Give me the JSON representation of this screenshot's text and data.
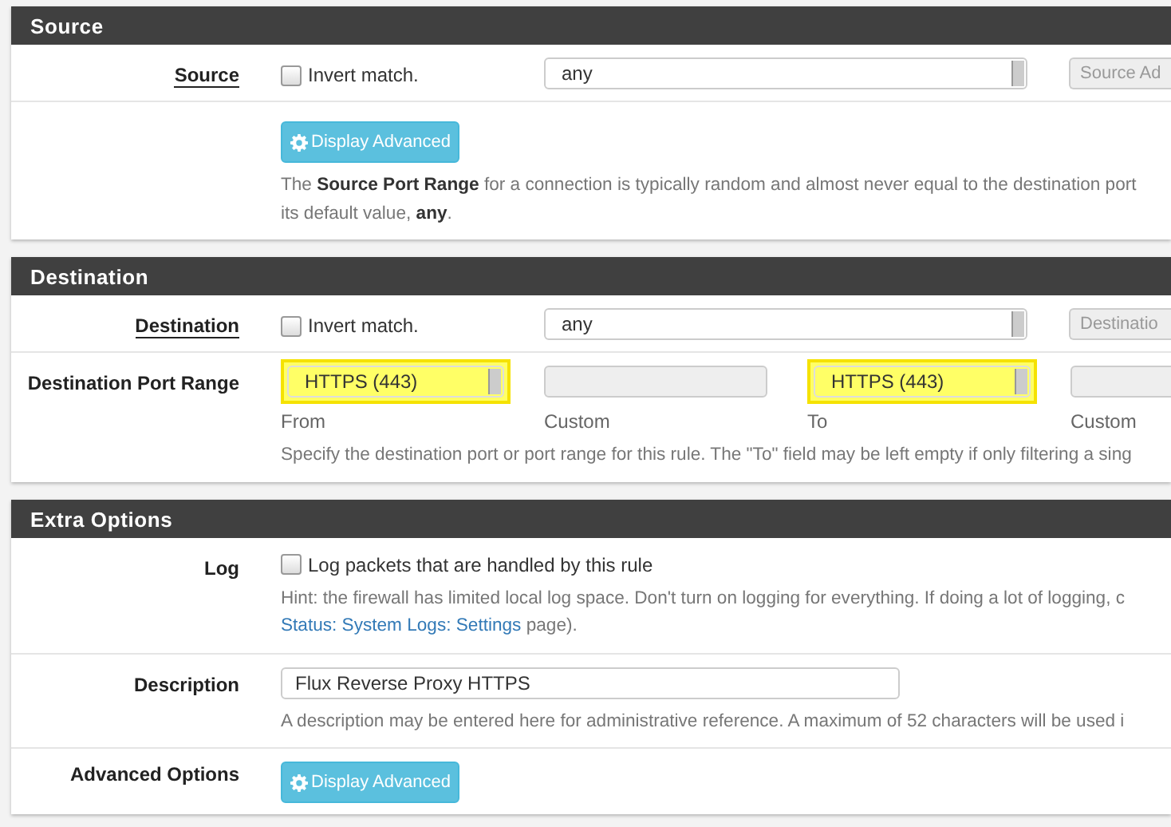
{
  "sections": [
    {
      "title": "Source",
      "rows": [
        {
          "kind": "match",
          "label": "Source",
          "invert": {
            "label": "Invert match.",
            "checked": false
          },
          "select": "any",
          "address_placeholder": "Source Ad"
        },
        {
          "kind": "advanced",
          "button": "Display Advanced",
          "help": "The **Source Port Range** for a connection is typically random and almost never equal to the destination port",
          "help_2": "its default value, **any**."
        }
      ]
    },
    {
      "title": "Destination",
      "rows": [
        {
          "kind": "match",
          "label": "Destination",
          "invert": {
            "label": "Invert match.",
            "checked": false
          },
          "select": "any",
          "address_placeholder": "Destinatio"
        },
        {
          "kind": "port_range",
          "label": "Destination Port Range",
          "ports": [
            {
              "select": "HTTPS (443)",
              "highlighted": true,
              "caption": "From",
              "custom_caption": "Custom"
            },
            {
              "select": "HTTPS (443)",
              "highlighted": true,
              "caption": "To",
              "custom_caption": "Custom"
            }
          ],
          "help": "Specify the destination port or port range for this rule. The \"To\" field may be left empty if only filtering a sing"
        }
      ]
    },
    {
      "title": "Extra Options",
      "rows": [
        {
          "kind": "checkbox",
          "label": "Log",
          "checkbox": {
            "label": "Log packets that are handled by this rule",
            "checked": false
          },
          "hint": "Hint: the firewall has limited local log space. Don't turn on logging for everything. If doing a lot of logging, c",
          "link": "Status: System Logs: Settings",
          "hint_after": " page)."
        },
        {
          "kind": "text",
          "label": "Description",
          "value": "Flux Reverse Proxy HTTPS",
          "help": "A description may be entered here for administrative reference. A maximum of 52 characters will be used i"
        },
        {
          "kind": "button",
          "label": "Advanced Options",
          "button": "Display Advanced"
        }
      ]
    }
  ]
}
